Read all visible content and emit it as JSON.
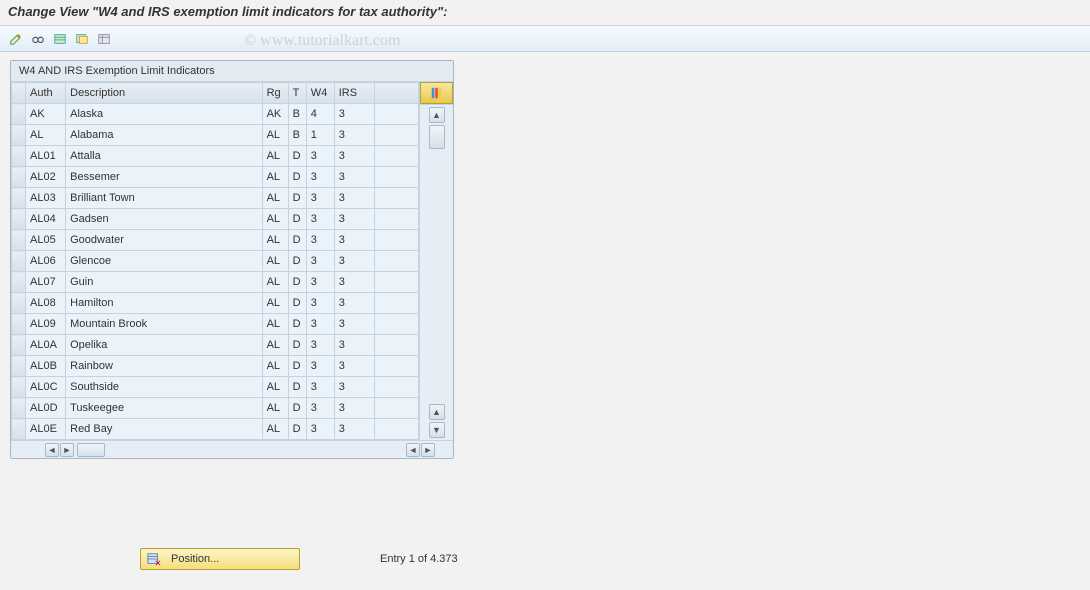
{
  "title": "Change View \"W4 and IRS exemption limit indicators for tax authority\":",
  "watermark": "© www.tutorialkart.com",
  "toolbar": {
    "icons": [
      "change-icon",
      "copy-icon",
      "new-entries-icon",
      "save-icon",
      "delete-icon"
    ]
  },
  "panel": {
    "title": "W4 AND IRS Exemption Limit Indicators",
    "columns": {
      "auth": "Auth",
      "desc": "Description",
      "rg": "Rg",
      "t": "T",
      "w4": "W4",
      "irs": "IRS"
    },
    "rows": [
      {
        "auth": "AK",
        "desc": "Alaska",
        "rg": "AK",
        "t": "B",
        "w4": "4",
        "irs": "3"
      },
      {
        "auth": "AL",
        "desc": "Alabama",
        "rg": "AL",
        "t": "B",
        "w4": "1",
        "irs": "3"
      },
      {
        "auth": "AL01",
        "desc": "Attalla",
        "rg": "AL",
        "t": "D",
        "w4": "3",
        "irs": "3"
      },
      {
        "auth": "AL02",
        "desc": "Bessemer",
        "rg": "AL",
        "t": "D",
        "w4": "3",
        "irs": "3"
      },
      {
        "auth": "AL03",
        "desc": "Brilliant Town",
        "rg": "AL",
        "t": "D",
        "w4": "3",
        "irs": "3"
      },
      {
        "auth": "AL04",
        "desc": "Gadsen",
        "rg": "AL",
        "t": "D",
        "w4": "3",
        "irs": "3"
      },
      {
        "auth": "AL05",
        "desc": "Goodwater",
        "rg": "AL",
        "t": "D",
        "w4": "3",
        "irs": "3"
      },
      {
        "auth": "AL06",
        "desc": "Glencoe",
        "rg": "AL",
        "t": "D",
        "w4": "3",
        "irs": "3"
      },
      {
        "auth": "AL07",
        "desc": "Guin",
        "rg": "AL",
        "t": "D",
        "w4": "3",
        "irs": "3"
      },
      {
        "auth": "AL08",
        "desc": "Hamilton",
        "rg": "AL",
        "t": "D",
        "w4": "3",
        "irs": "3"
      },
      {
        "auth": "AL09",
        "desc": "Mountain Brook",
        "rg": "AL",
        "t": "D",
        "w4": "3",
        "irs": "3"
      },
      {
        "auth": "AL0A",
        "desc": "Opelika",
        "rg": "AL",
        "t": "D",
        "w4": "3",
        "irs": "3"
      },
      {
        "auth": "AL0B",
        "desc": "Rainbow",
        "rg": "AL",
        "t": "D",
        "w4": "3",
        "irs": "3"
      },
      {
        "auth": "AL0C",
        "desc": "Southside",
        "rg": "AL",
        "t": "D",
        "w4": "3",
        "irs": "3"
      },
      {
        "auth": "AL0D",
        "desc": "Tuskeegee",
        "rg": "AL",
        "t": "D",
        "w4": "3",
        "irs": "3"
      },
      {
        "auth": "AL0E",
        "desc": "Red Bay",
        "rg": "AL",
        "t": "D",
        "w4": "3",
        "irs": "3"
      }
    ]
  },
  "footer": {
    "position_label": "Position...",
    "entry_text": "Entry 1 of 4.373"
  }
}
